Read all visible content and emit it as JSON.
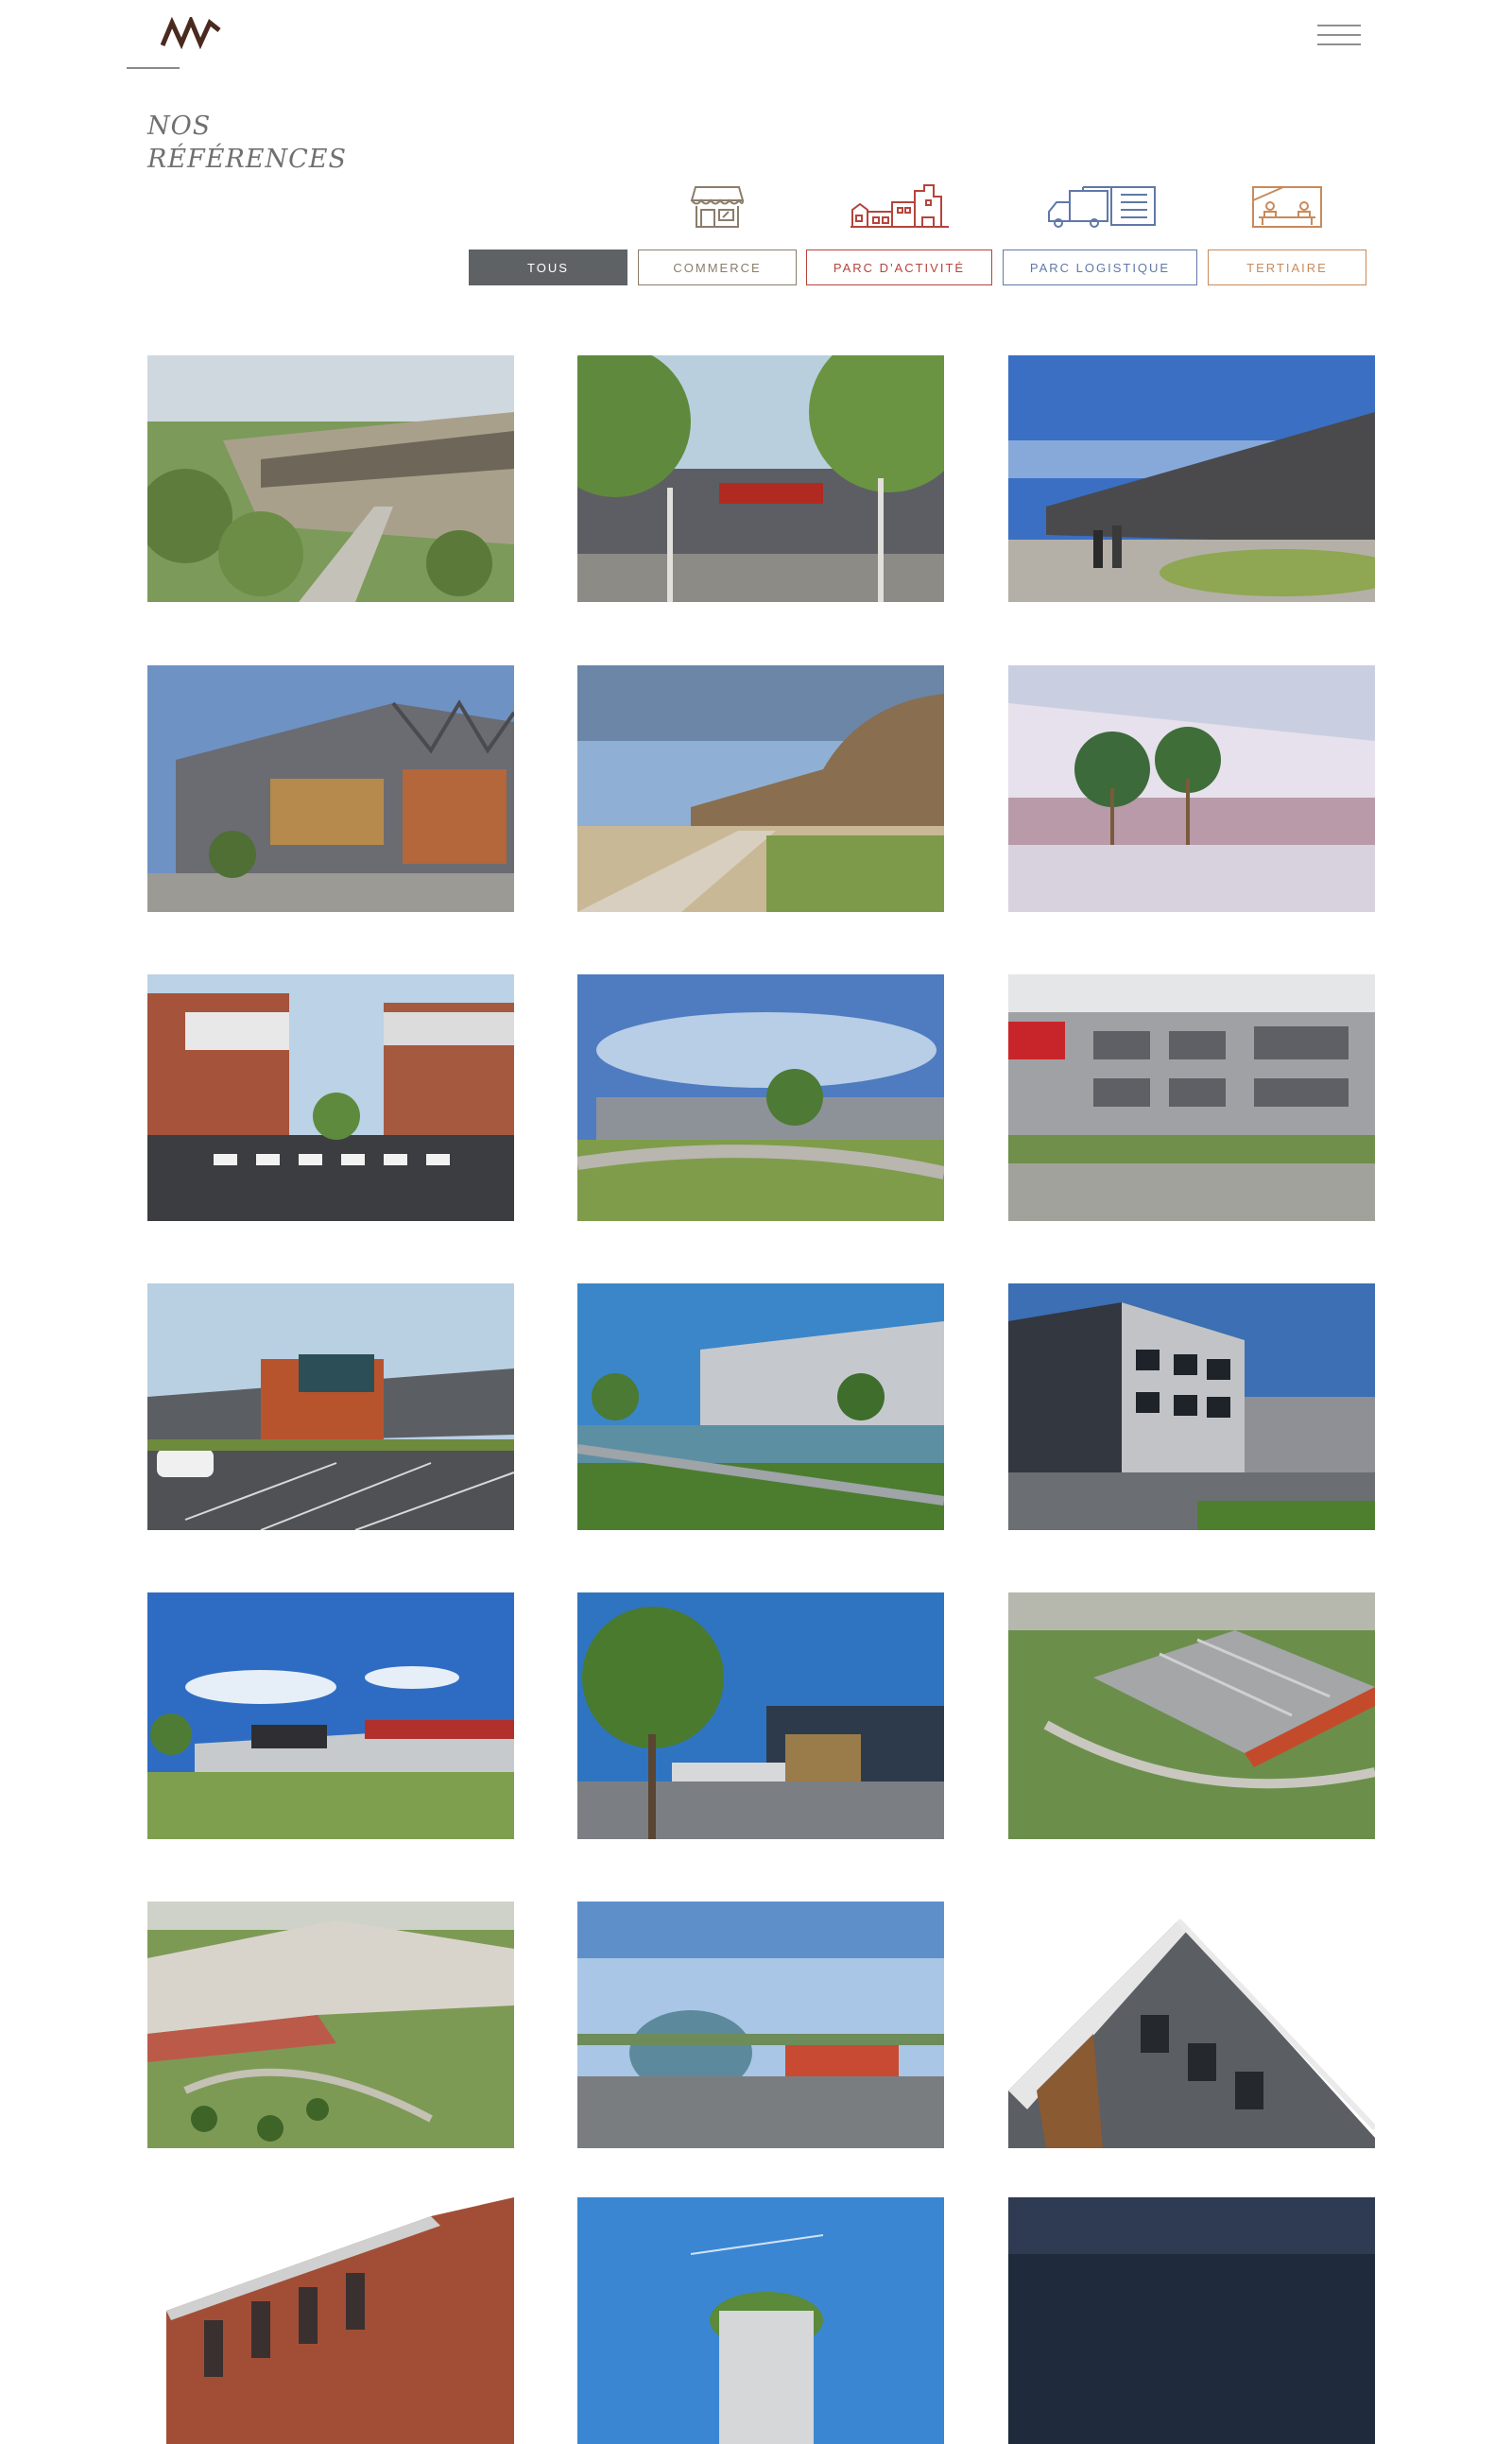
{
  "header": {
    "logo_text": "MW",
    "menu_icon": "hamburger-icon"
  },
  "page": {
    "title_line1": "NOS",
    "title_line2": "RÉFÉRENCES"
  },
  "filters": [
    {
      "label": "TOUS",
      "active": true,
      "color": "#5f6264",
      "icon": null
    },
    {
      "label": "COMMERCE",
      "active": false,
      "color": "#8a7d6b",
      "icon": "shop-icon"
    },
    {
      "label": "PARC D'ACTIVITÉ",
      "active": false,
      "color": "#b5443b",
      "icon": "factory-icon"
    },
    {
      "label": "PARC LOGISTIQUE",
      "active": false,
      "color": "#5f78a8",
      "icon": "truck-warehouse-icon"
    },
    {
      "label": "TERTIAIRE",
      "active": false,
      "color": "#c98a5a",
      "icon": "office-desk-icon"
    }
  ],
  "references": [
    {
      "alt": "mixed-use building with green terraces"
    },
    {
      "alt": "shopping center entrance with trees"
    },
    {
      "alt": "modern curved retail facade"
    },
    {
      "alt": "pitched-roof building with large screen"
    },
    {
      "alt": "curved wooden building with path"
    },
    {
      "alt": "mall interior with palm trees"
    },
    {
      "alt": "brick business park with crossing"
    },
    {
      "alt": "logistics warehouse under blue sky"
    },
    {
      "alt": "grey office building with red accent"
    },
    {
      "alt": "prologis business park"
    },
    {
      "alt": "warehouse by a pond"
    },
    {
      "alt": "three-storey dark office building"
    },
    {
      "alt": "long warehouse in green field"
    },
    {
      "alt": "building behind large tree"
    },
    {
      "alt": "aerial view of logistic platform"
    },
    {
      "alt": "aerial view of large warehouses"
    },
    {
      "alt": "round glass pavilion"
    },
    {
      "alt": "angular office building corner"
    },
    {
      "alt": "brick industrial building"
    },
    {
      "alt": "building with green roof"
    },
    {
      "alt": "night view building"
    }
  ]
}
